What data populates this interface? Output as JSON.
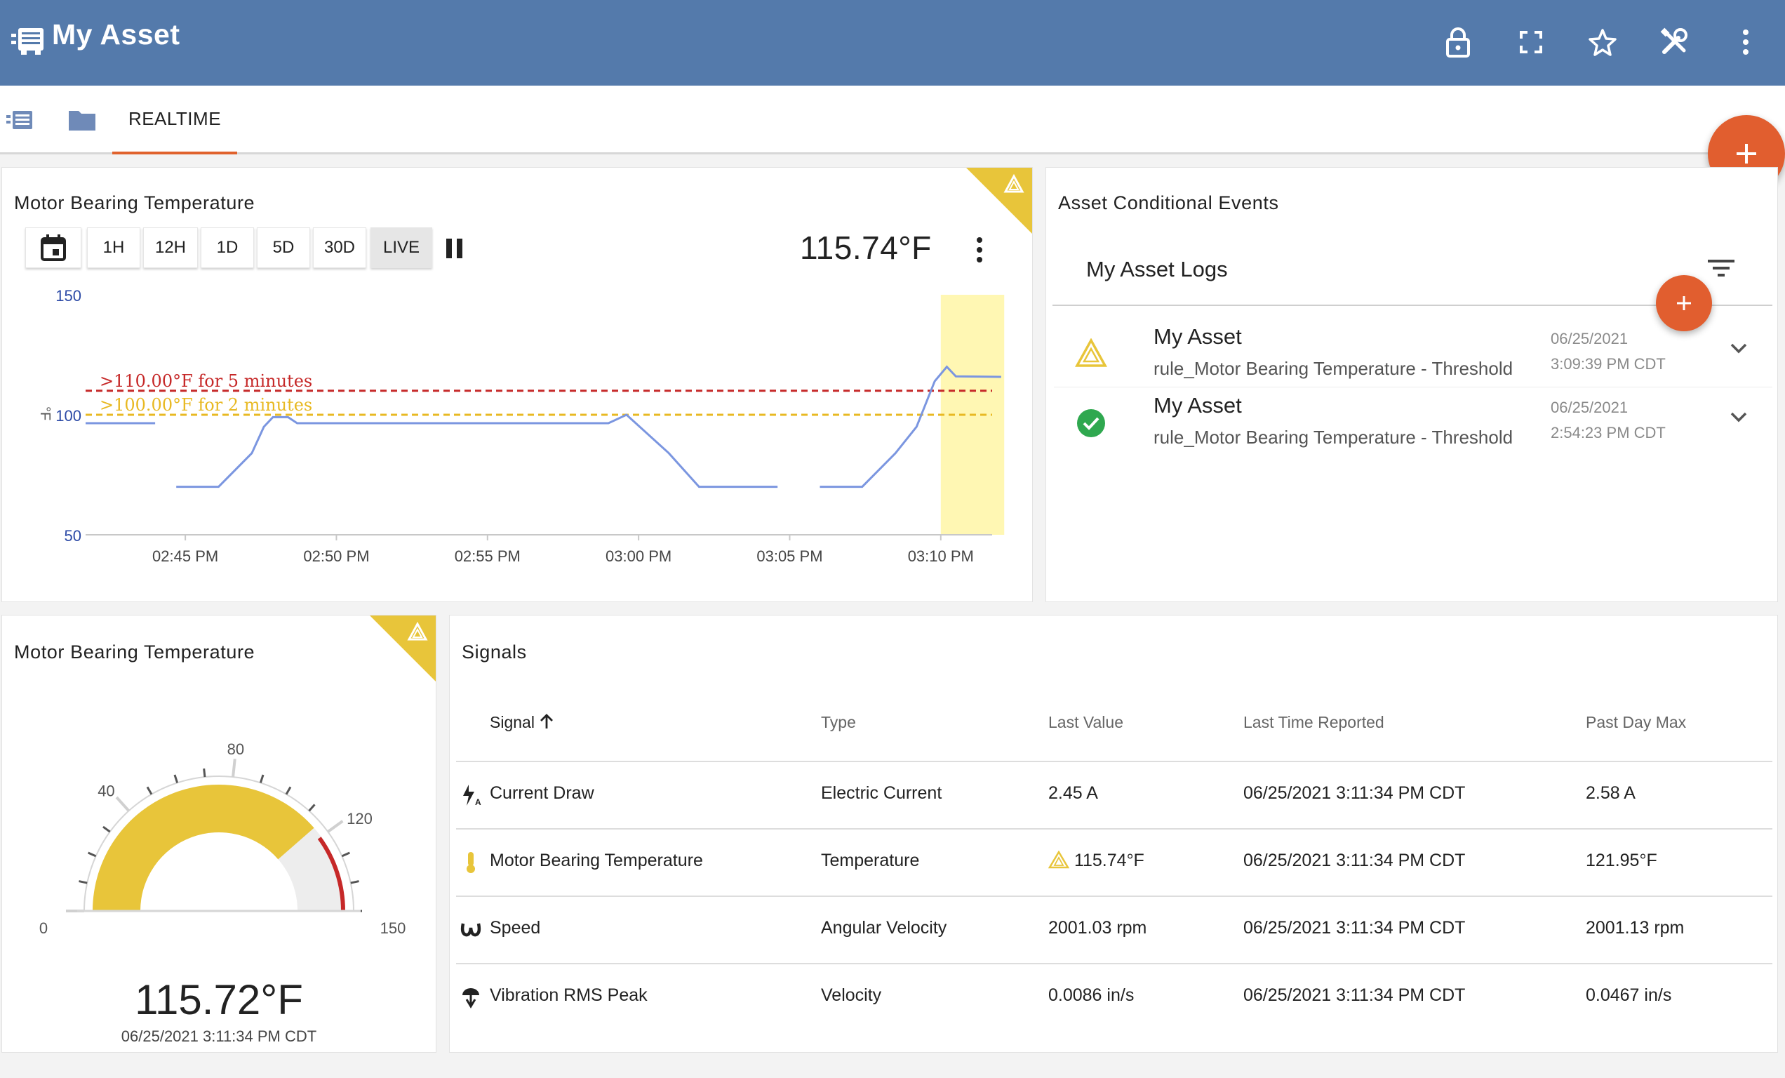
{
  "header": {
    "title": "My Asset",
    "accent": "#547aab",
    "actions": [
      "lock-icon",
      "fullscreen-icon",
      "star-icon",
      "tools-icon",
      "more-vert-icon"
    ]
  },
  "tabs": {
    "active_label": "REALTIME",
    "icons": [
      "asset-icon",
      "folder-icon"
    ],
    "underline_color": "#e0622d"
  },
  "chart_card": {
    "title": "Motor Bearing Temperature",
    "ranges": [
      "1H",
      "12H",
      "1D",
      "5D",
      "30D",
      "LIVE"
    ],
    "active_range": "LIVE",
    "current_value": "115.74°F",
    "y_unit": "°F"
  },
  "chart_data": {
    "type": "line",
    "title": "Motor Bearing Temperature",
    "ylabel": "°F",
    "ylim": [
      50,
      150
    ],
    "y_ticks": [
      "150",
      "100",
      "50"
    ],
    "x_ticks": [
      "02:45 PM",
      "02:50 PM",
      "02:55 PM",
      "03:00 PM",
      "03:05 PM",
      "03:10 PM"
    ],
    "x_domain_minutes": [
      -3.3,
      26.7
    ],
    "thresholds": [
      {
        "label": ">110.00°F for 5 minutes",
        "value": 110,
        "color": "#c62828"
      },
      {
        "label": ">100.00°F for 2 minutes",
        "value": 100,
        "color": "#e8b923"
      }
    ],
    "alarm_window_minutes": [
      25.0,
      27.1
    ],
    "series": [
      {
        "color": "#7b96e0",
        "segments": [
          [
            [
              -3.3,
              96.5
            ],
            [
              -1.0,
              96.5
            ]
          ],
          [
            [
              -0.3,
              70
            ],
            [
              1.1,
              70
            ],
            [
              2.2,
              84
            ],
            [
              2.6,
              95
            ],
            [
              2.9,
              99
            ],
            [
              3.4,
              99
            ],
            [
              3.7,
              96.5
            ],
            [
              14.0,
              96.5
            ],
            [
              14.6,
              100
            ],
            [
              16.0,
              84
            ],
            [
              17.0,
              70
            ],
            [
              19.6,
              70
            ]
          ],
          [
            [
              21.0,
              70
            ],
            [
              22.4,
              70
            ],
            [
              23.5,
              84
            ],
            [
              24.2,
              95
            ],
            [
              24.8,
              114
            ],
            [
              25.2,
              120
            ],
            [
              25.5,
              116
            ],
            [
              27.0,
              115.8
            ]
          ]
        ]
      }
    ],
    "grid": false
  },
  "events_card": {
    "title": "Asset Conditional Events",
    "logs_title": "My Asset Logs",
    "items": [
      {
        "name": "My Asset",
        "rule": "rule_Motor Bearing Temperature - Threshold",
        "date": "06/25/2021",
        "time": "3:09:39 PM CDT",
        "status": "warning"
      },
      {
        "name": "My Asset",
        "rule": "rule_Motor Bearing Temperature - Threshold",
        "date": "06/25/2021",
        "time": "2:54:23 PM CDT",
        "status": "ok"
      }
    ]
  },
  "gauge_card": {
    "title": "Motor Bearing Temperature",
    "value": "115.72°F",
    "value_number": 115.72,
    "min": 0,
    "max": 150,
    "timestamp": "06/25/2021 3:11:34 PM CDT",
    "labels": {
      "min": "0",
      "l40": "40",
      "l80": "80",
      "l120": "120",
      "max": "150"
    },
    "warning_from": 120,
    "fill_color": "#e8c53a",
    "danger_color": "#c62828"
  },
  "signals": {
    "title": "Signals",
    "columns": [
      "Signal",
      "Type",
      "Last Value",
      "Last Time Reported",
      "Past Day Max"
    ],
    "rows": [
      {
        "icon": "current-icon",
        "signal": "Current Draw",
        "type": "Electric Current",
        "last": "2.45 A",
        "time": "06/25/2021 3:11:34 PM CDT",
        "max": "2.58 A",
        "warn": false
      },
      {
        "icon": "thermometer-icon",
        "signal": "Motor Bearing Temperature",
        "type": "Temperature",
        "last": "115.74°F",
        "time": "06/25/2021 3:11:34 PM CDT",
        "max": "121.95°F",
        "warn": true
      },
      {
        "icon": "omega-icon",
        "signal": "Speed",
        "type": "Angular Velocity",
        "last": "2001.03 rpm",
        "time": "06/25/2021 3:11:34 PM CDT",
        "max": "2001.13 rpm",
        "warn": false
      },
      {
        "icon": "vibration-icon",
        "signal": "Vibration RMS Peak",
        "type": "Velocity",
        "last": "0.0086 in/s",
        "time": "06/25/2021 3:11:34 PM CDT",
        "max": "0.0467 in/s",
        "warn": false
      }
    ]
  },
  "colors": {
    "warning_yellow": "#e8c53a",
    "ok_green": "#2fa84f",
    "fab_orange": "#e15e2f"
  }
}
